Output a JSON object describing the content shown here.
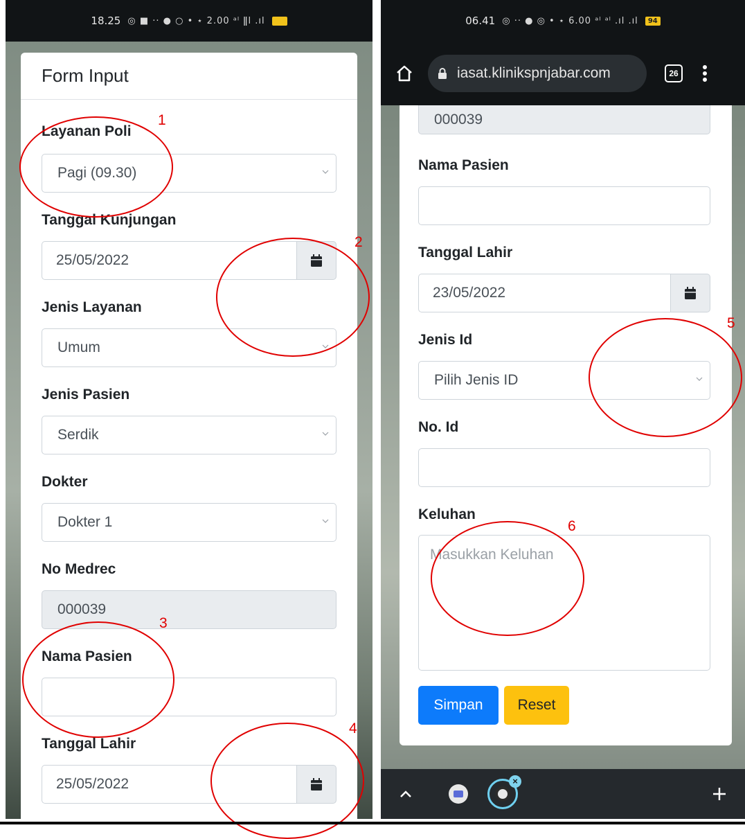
{
  "left_phone": {
    "status": {
      "time": "18.25",
      "indicators": "◎ ■ ·· ● ○ •   ⋆ 2.00 ᵃˡ ǁl .ıl",
      "battery": ""
    },
    "form": {
      "title": "Form Input",
      "layanan_poli": {
        "label": "Layanan Poli",
        "value": "Pagi (09.30)"
      },
      "tanggal_kunjungan": {
        "label": "Tanggal Kunjungan",
        "value": "25/05/2022"
      },
      "jenis_layanan": {
        "label": "Jenis Layanan",
        "value": "Umum"
      },
      "jenis_pasien": {
        "label": "Jenis Pasien",
        "value": "Serdik"
      },
      "dokter": {
        "label": "Dokter",
        "value": "Dokter 1"
      },
      "no_medrec": {
        "label": "No Medrec",
        "value": "000039"
      },
      "nama_pasien": {
        "label": "Nama Pasien",
        "value": ""
      },
      "tanggal_lahir": {
        "label": "Tanggal Lahir",
        "value": "25/05/2022"
      }
    }
  },
  "right_phone": {
    "status": {
      "time": "06.41",
      "indicators": "◎ ·· ● ◎ •   ⋆ 6.00 ᵃˡ ᵃˡ .ıl .ıl",
      "battery": "94"
    },
    "browser": {
      "url": "iasat.klinikspnjabar.com",
      "tab_count": "26"
    },
    "form": {
      "no_medrec_value": "000039",
      "nama_pasien": {
        "label": "Nama Pasien",
        "value": ""
      },
      "tanggal_lahir": {
        "label": "Tanggal Lahir",
        "value": "23/05/2022"
      },
      "jenis_id": {
        "label": "Jenis Id",
        "value": "Pilih Jenis ID"
      },
      "no_id": {
        "label": "No. Id",
        "value": ""
      },
      "keluhan": {
        "label": "Keluhan",
        "placeholder": "Masukkan Keluhan"
      },
      "save_label": "Simpan",
      "reset_label": "Reset"
    }
  },
  "annotations": {
    "n1": "1",
    "n2": "2",
    "n3": "3",
    "n4": "4",
    "n5": "5",
    "n6": "6",
    "color": "#e00000"
  }
}
